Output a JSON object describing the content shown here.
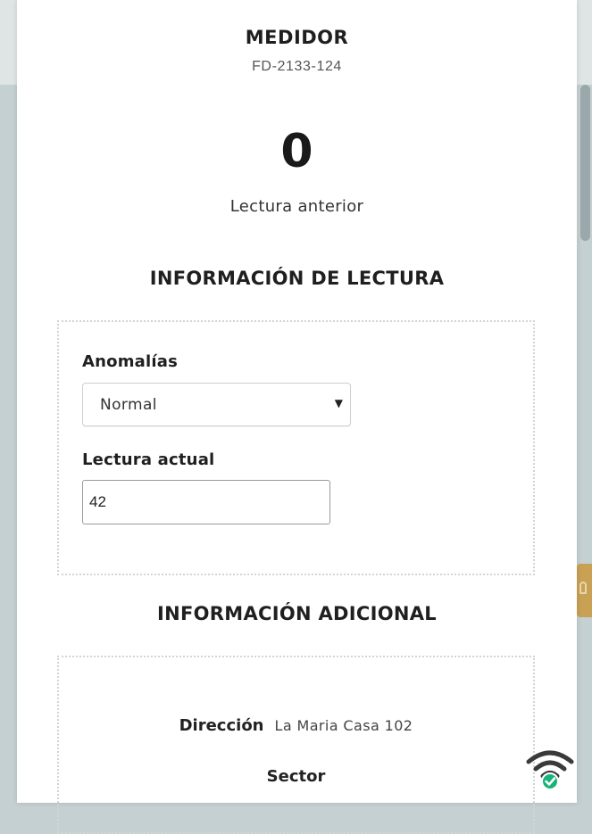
{
  "meter": {
    "title": "MEDIDOR",
    "code": "FD-2133-124"
  },
  "previous_reading": {
    "value": "0",
    "label": "Lectura anterior"
  },
  "reading_info": {
    "title": "INFORMACIÓN DE LECTURA",
    "anomalies_label": "Anomalías",
    "anomalies_selected": "Normal",
    "current_reading_label": "Lectura actual",
    "current_reading_value": "42"
  },
  "additional_info": {
    "title": "INFORMACIÓN ADICIONAL",
    "address_label": "Dirección",
    "address_value": "La Maria Casa 102",
    "sector_label": "Sector"
  },
  "status": {
    "connection_icon": "wifi-connected-icon",
    "check_color": "#19b37a"
  },
  "colors": {
    "accent_tab": "#c8a154"
  }
}
